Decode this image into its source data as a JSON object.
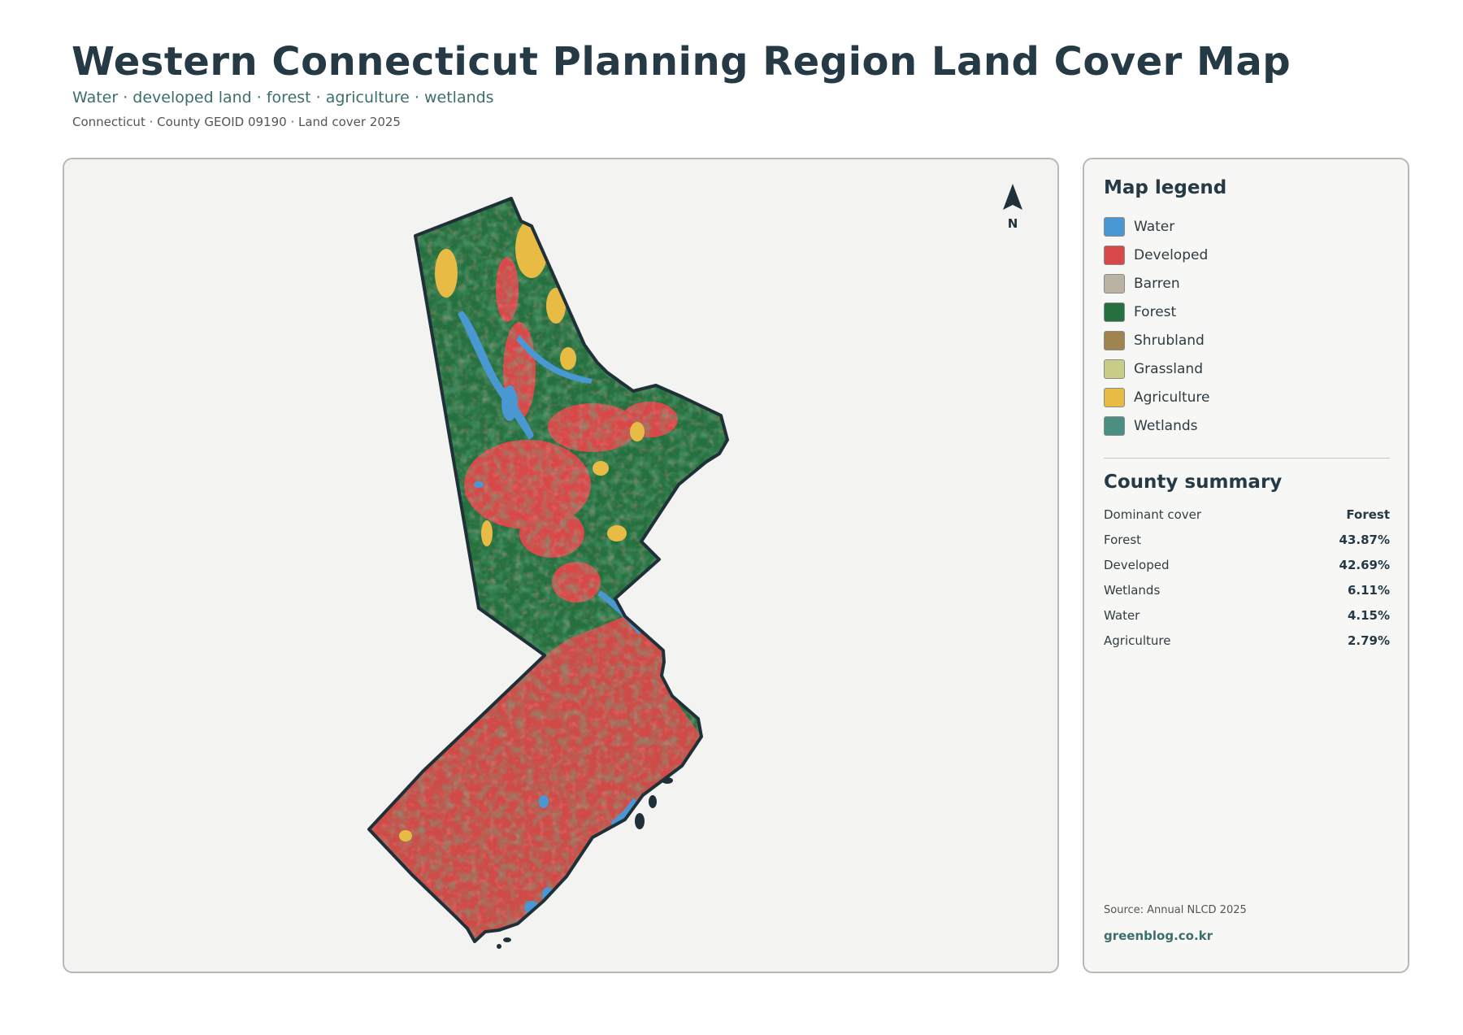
{
  "header": {
    "title": "Western Connecticut Planning Region Land Cover Map",
    "subtitle": "Water · developed land · forest · agriculture · wetlands",
    "caption": "Connecticut · County GEOID 09190 · Land cover 2025"
  },
  "map": {
    "north_label": "N",
    "colors": {
      "background": "#f3f3f2",
      "outline": "#1f3038",
      "water": "#4a98d3",
      "developed": "#d94848",
      "forest": "#25703f",
      "agriculture": "#e8bb45",
      "wetlands": "#4a8f82",
      "shrubland": "#a08450",
      "grassland": "#c9cd86",
      "barren": "#bbb3a1"
    }
  },
  "legend": {
    "title": "Map legend",
    "items": [
      {
        "label": "Water",
        "color": "#4a98d3"
      },
      {
        "label": "Developed",
        "color": "#d94848"
      },
      {
        "label": "Barren",
        "color": "#bbb3a1"
      },
      {
        "label": "Forest",
        "color": "#25703f"
      },
      {
        "label": "Shrubland",
        "color": "#a08450"
      },
      {
        "label": "Grassland",
        "color": "#c9cd86"
      },
      {
        "label": "Agriculture",
        "color": "#e8bb45"
      },
      {
        "label": "Wetlands",
        "color": "#4a8f82"
      }
    ]
  },
  "summary": {
    "title": "County summary",
    "rows": [
      {
        "label": "Dominant cover",
        "value": "Forest"
      },
      {
        "label": "Forest",
        "value": "43.87%"
      },
      {
        "label": "Developed",
        "value": "42.69%"
      },
      {
        "label": "Wetlands",
        "value": "6.11%"
      },
      {
        "label": "Water",
        "value": "4.15%"
      },
      {
        "label": "Agriculture",
        "value": "2.79%"
      }
    ]
  },
  "footer": {
    "source": "Source: Annual NLCD 2025",
    "site": "greenblog.co.kr"
  }
}
